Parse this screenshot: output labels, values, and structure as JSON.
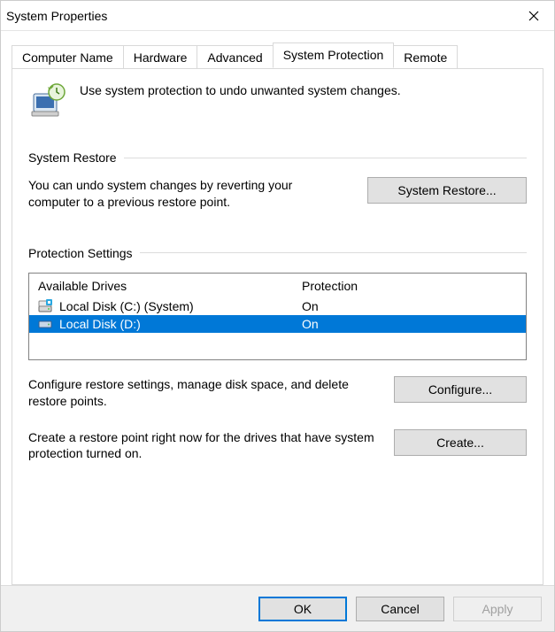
{
  "window": {
    "title": "System Properties"
  },
  "tabs": [
    {
      "label": "Computer Name"
    },
    {
      "label": "Hardware"
    },
    {
      "label": "Advanced"
    },
    {
      "label": "System Protection",
      "active": true
    },
    {
      "label": "Remote"
    }
  ],
  "intro": {
    "text": "Use system protection to undo unwanted system changes."
  },
  "sectionSystemRestore": {
    "label": "System Restore",
    "text": "You can undo system changes by reverting your computer to a previous restore point.",
    "button": "System Restore..."
  },
  "sectionProtection": {
    "label": "Protection Settings",
    "columns": {
      "drive": "Available Drives",
      "protection": "Protection"
    },
    "rows": [
      {
        "name": "Local Disk (C:) (System)",
        "protection": "On",
        "selected": false,
        "icon": "drive-system"
      },
      {
        "name": "Local Disk (D:)",
        "protection": "On",
        "selected": true,
        "icon": "drive"
      }
    ],
    "configureText": "Configure restore settings, manage disk space, and delete restore points.",
    "configureButton": "Configure...",
    "createText": "Create a restore point right now for the drives that have system protection turned on.",
    "createButton": "Create..."
  },
  "footer": {
    "ok": "OK",
    "cancel": "Cancel",
    "apply": "Apply"
  }
}
